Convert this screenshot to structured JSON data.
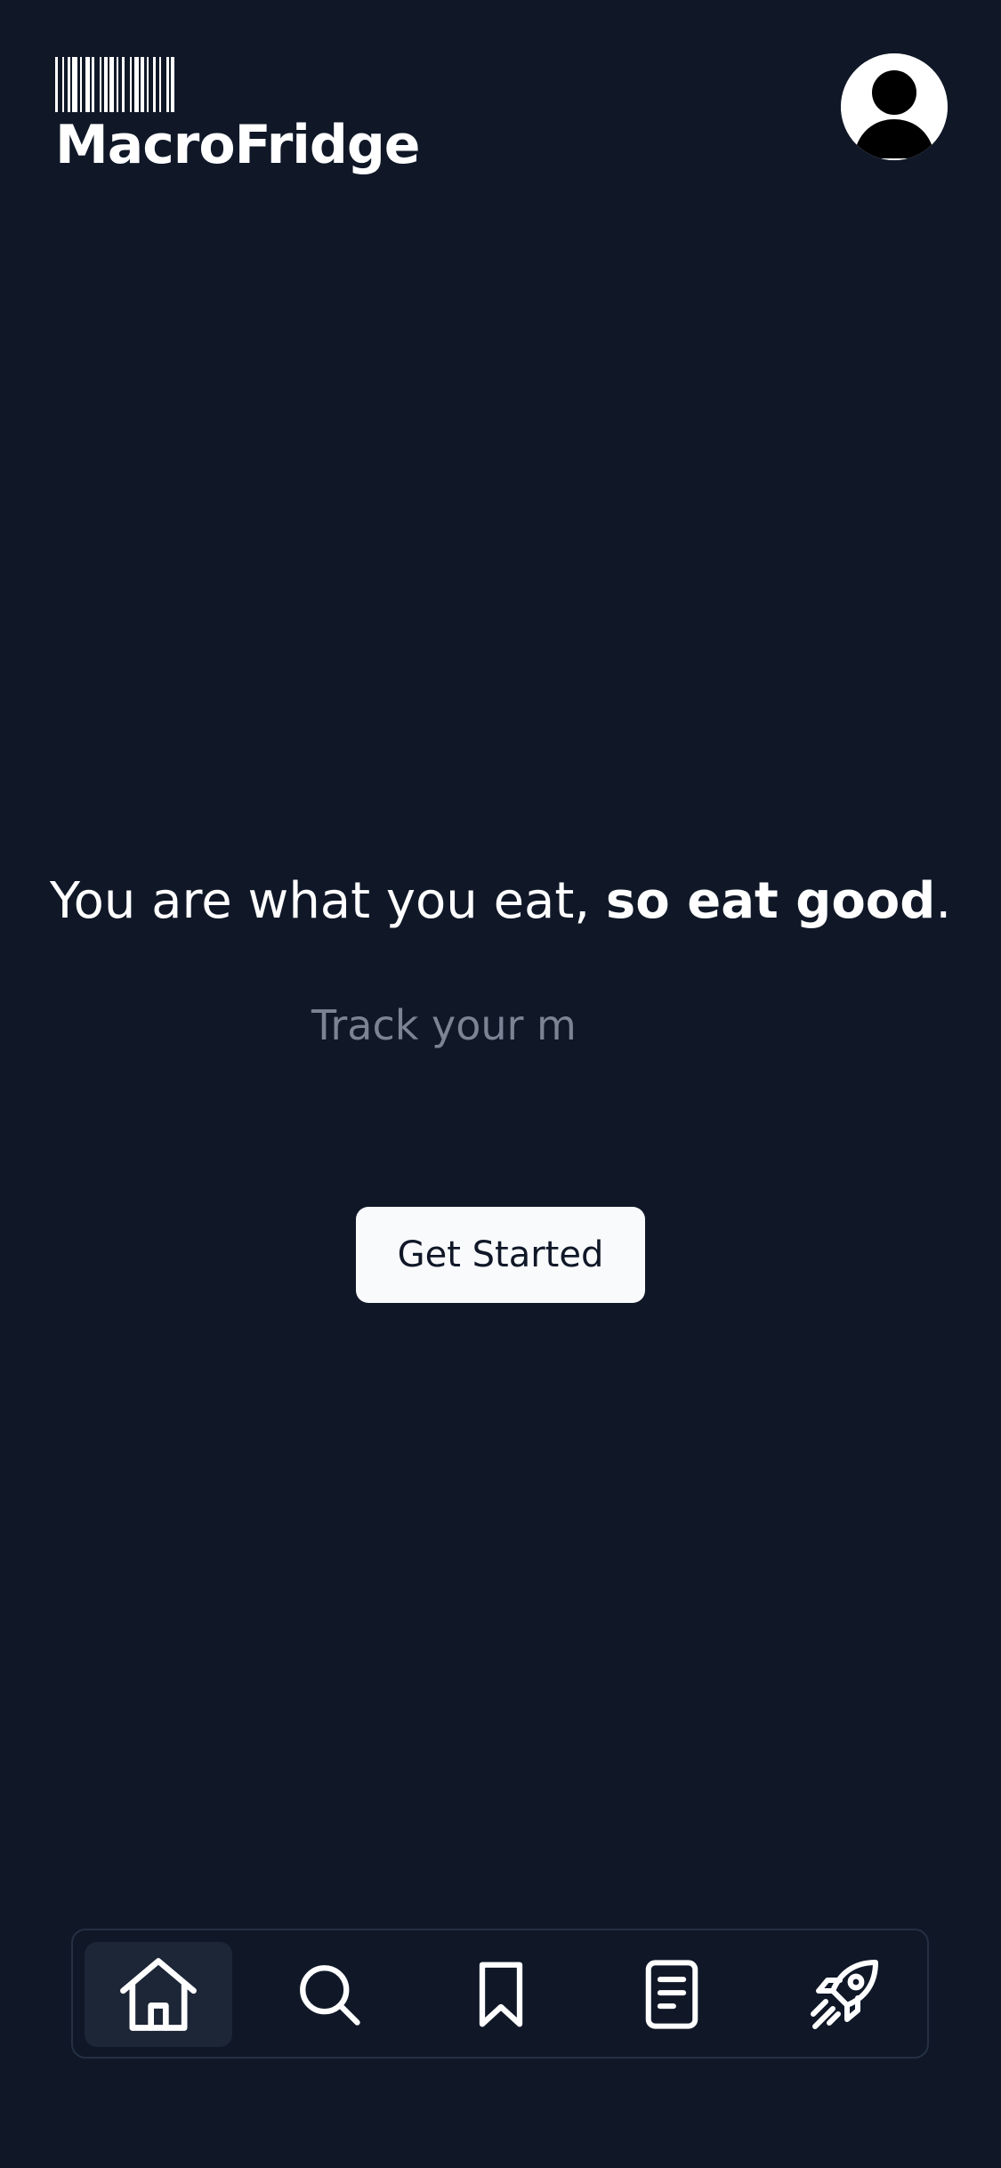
{
  "app": {
    "logo_text": "MacroFridge",
    "logo_barcode_icon": "barcode-icon",
    "avatar_icon": "user-avatar-icon"
  },
  "hero": {
    "tagline_regular": "You are what you eat, ",
    "tagline_bold": "so eat good",
    "tagline_end": ".",
    "subtext": "Track your m",
    "cta_label": "Get Started"
  },
  "bottom_nav": {
    "items": [
      {
        "id": "home",
        "icon": "home-icon",
        "active": true
      },
      {
        "id": "search",
        "icon": "search-icon",
        "active": false
      },
      {
        "id": "saved",
        "icon": "bookmark-icon",
        "active": false
      },
      {
        "id": "log",
        "icon": "document-icon",
        "active": false
      },
      {
        "id": "launch",
        "icon": "rocket-icon",
        "active": false
      }
    ]
  },
  "colors": {
    "background": "#101828",
    "text_primary": "#ffffff",
    "text_muted": "#7c8494",
    "button_bg": "#f8fafc",
    "nav_active_bg": "#1c2636",
    "nav_border": "#243042"
  }
}
